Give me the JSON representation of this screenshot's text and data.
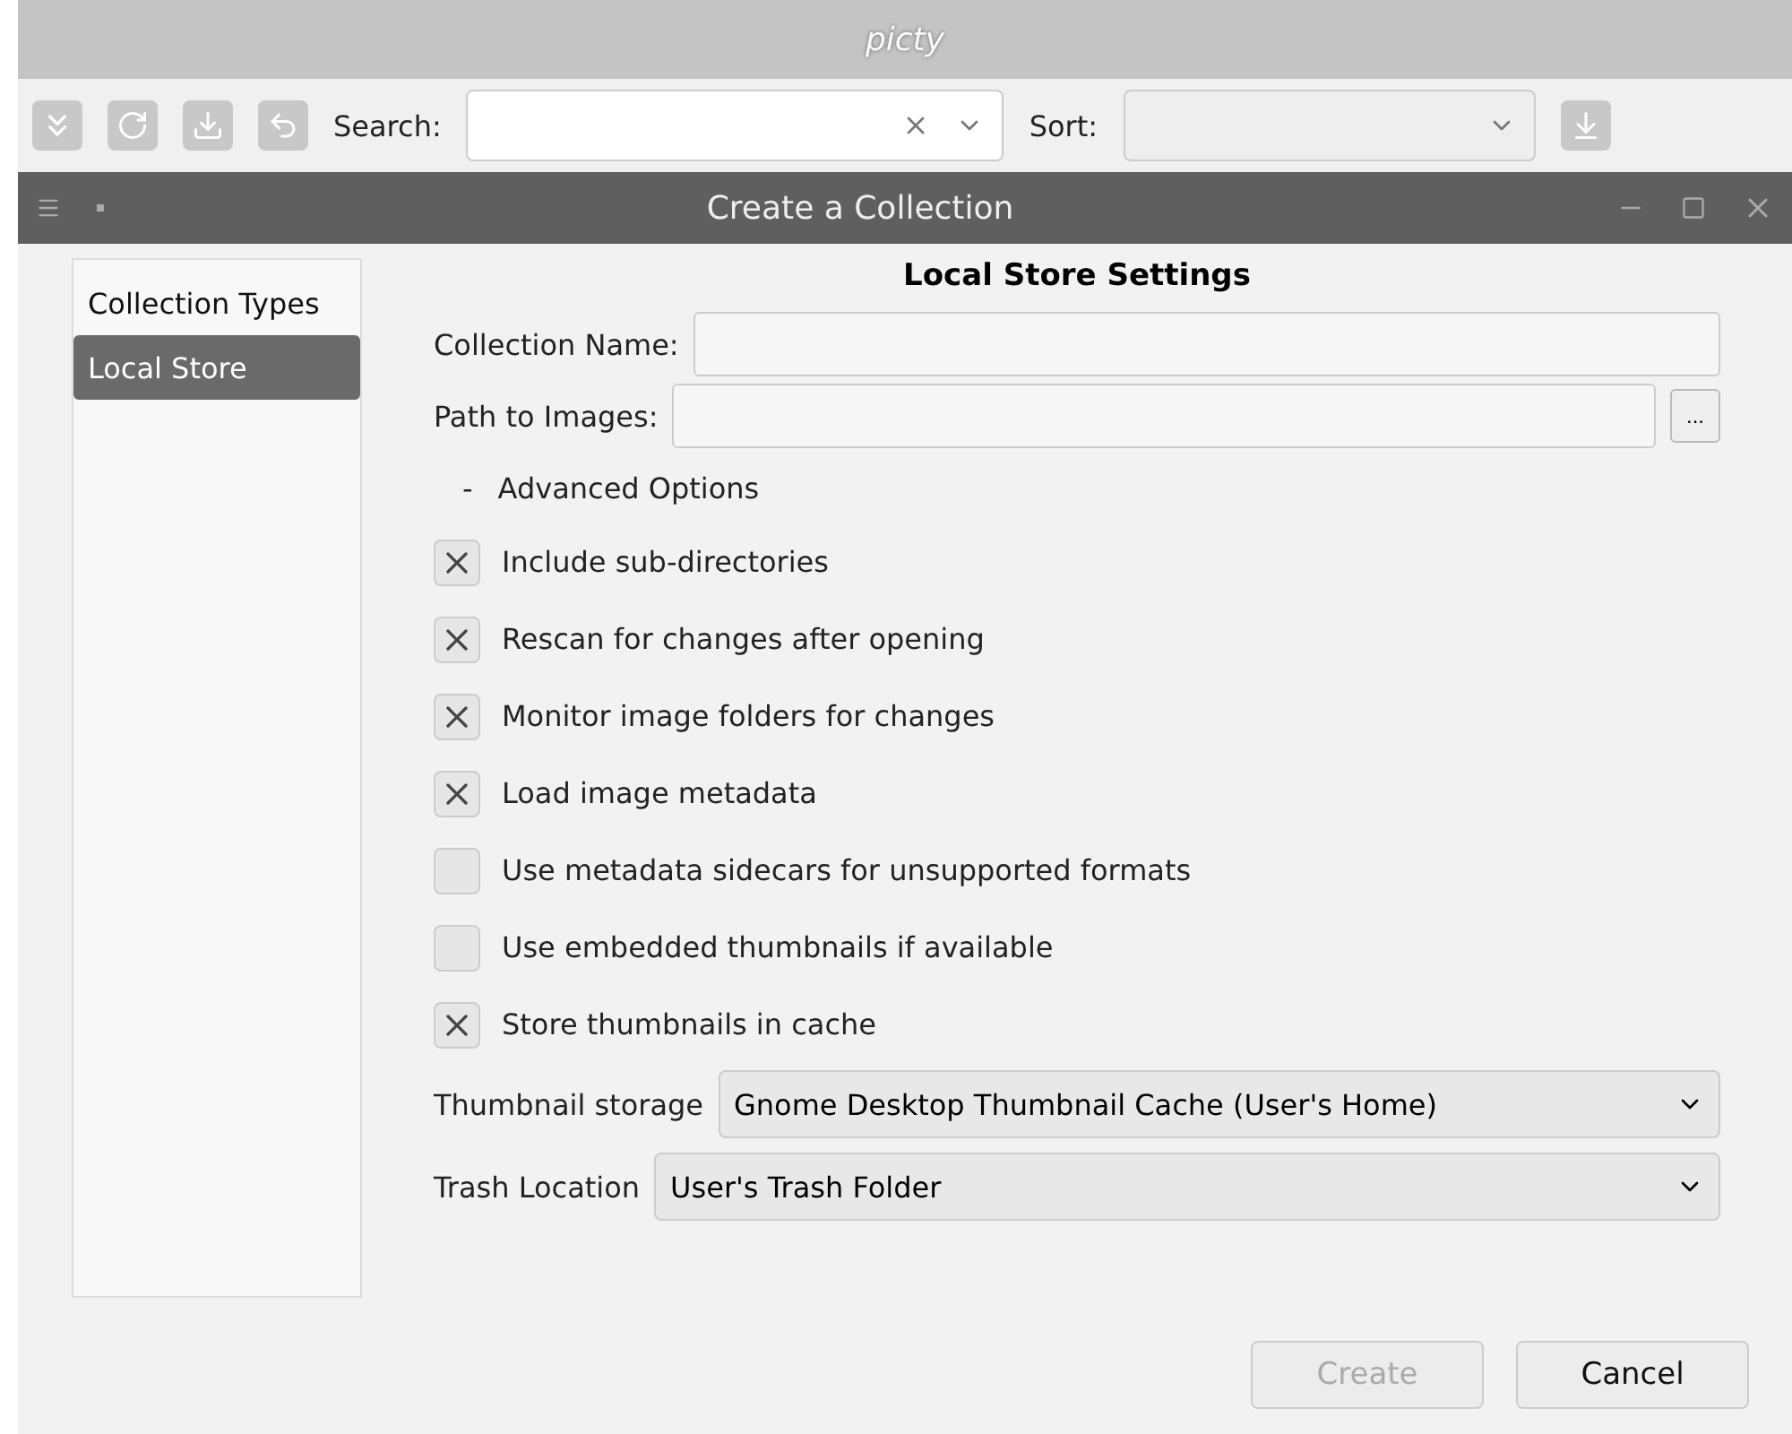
{
  "main_window": {
    "title": "picty",
    "search_label": "Search:",
    "sort_label": "Sort:"
  },
  "dialog": {
    "title": "Create a Collection",
    "sidebar": {
      "items": [
        {
          "label": "Collection Types",
          "selected": false
        },
        {
          "label": "Local Store",
          "selected": true
        }
      ]
    },
    "heading": "Local Store Settings",
    "fields": [
      {
        "label": "Collection Name:",
        "kind": "text"
      },
      {
        "label": "Path to Images:",
        "kind": "path",
        "browse": "..."
      }
    ],
    "advanced": {
      "label": "Advanced Options",
      "toggle": "-",
      "expanded": true
    },
    "options": [
      {
        "label": "Include sub-directories",
        "checked": true
      },
      {
        "label": "Rescan for changes after opening",
        "checked": true
      },
      {
        "label": "Monitor image folders for changes",
        "checked": true
      },
      {
        "label": "Load image metadata",
        "checked": true
      },
      {
        "label": "Use metadata sidecars for unsupported formats",
        "checked": false
      },
      {
        "label": "Use embedded thumbnails if available",
        "checked": false
      },
      {
        "label": "Store thumbnails in cache",
        "checked": true
      }
    ],
    "selects": [
      {
        "label": "Thumbnail storage",
        "value": "Gnome Desktop Thumbnail Cache (User's Home)"
      },
      {
        "label": "Trash Location",
        "value": "User's Trash Folder"
      }
    ],
    "buttons": [
      {
        "label": "Create",
        "disabled": true
      },
      {
        "label": "Cancel",
        "disabled": false
      }
    ]
  }
}
